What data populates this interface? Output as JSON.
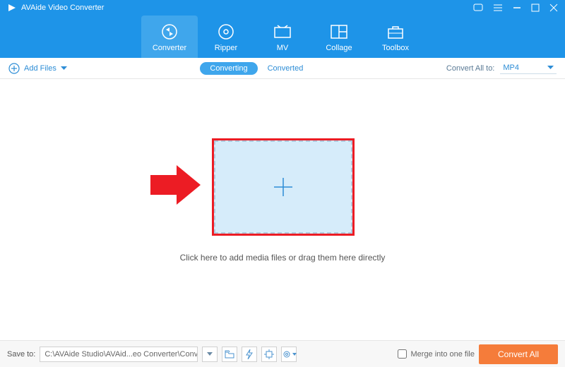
{
  "app": {
    "title": "AVAide Video Converter"
  },
  "nav": {
    "items": [
      {
        "label": "Converter"
      },
      {
        "label": "Ripper"
      },
      {
        "label": "MV"
      },
      {
        "label": "Collage"
      },
      {
        "label": "Toolbox"
      }
    ]
  },
  "subbar": {
    "addFiles": "Add Files",
    "tabs": {
      "converting": "Converting",
      "converted": "Converted"
    },
    "convertAllTo": "Convert All to:",
    "format": "MP4"
  },
  "main": {
    "hint": "Click here to add media files or drag them here directly"
  },
  "bottom": {
    "saveTo": "Save to:",
    "path": "C:\\AVAide Studio\\AVAid...eo Converter\\Converted",
    "merge": "Merge into one file",
    "convertAll": "Convert All"
  }
}
